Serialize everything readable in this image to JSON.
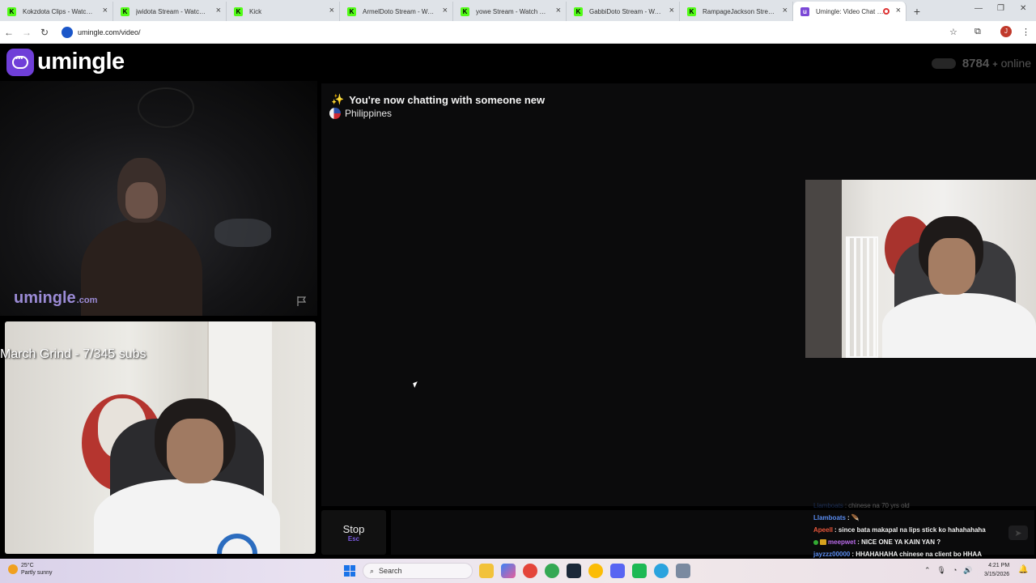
{
  "browser": {
    "tabs": [
      {
        "label": "Kokzdota Clips - Watch Live",
        "favicon": "kick-icon"
      },
      {
        "label": "jwidota Stream - Watch Live",
        "favicon": "kick-icon"
      },
      {
        "label": "Kick",
        "favicon": "kick-icon"
      },
      {
        "label": "ArmelDoto Stream - Watch",
        "favicon": "kick-icon"
      },
      {
        "label": "yowe Stream - Watch Live o",
        "favicon": "kick-icon"
      },
      {
        "label": "GabbiDoto Stream - Watch",
        "favicon": "kick-icon"
      },
      {
        "label": "RampageJackson Stream - W",
        "favicon": "kick-icon"
      },
      {
        "label": "Umingle: Video Chat with",
        "favicon": "umingle-icon",
        "active": true
      }
    ],
    "url": "umingle.com/video/",
    "profile_initial": "J"
  },
  "header": {
    "brand": "umingle",
    "online_count": "8784",
    "online_suffix": "+",
    "online_label": "online"
  },
  "partner_video": {
    "watermark_main": "umingle",
    "watermark_tld": ".com"
  },
  "self_video": {
    "overlay_text": "March Grind - 7/345 subs"
  },
  "chat": {
    "system_message": "You're now chatting with someone new",
    "country": "Philippines"
  },
  "controls": {
    "stop_label": "Stop",
    "stop_hotkey": "Esc"
  },
  "stream_chat": [
    {
      "user": "Llamboats",
      "message": "chinese na 70 yrs old",
      "user_color": "#3f6fd8",
      "faded": true
    },
    {
      "user": "Llamboats",
      "message": ":",
      "user_color": "#5a8cf0"
    },
    {
      "user": "Apeell",
      "message": ": since bata makapal na lips stick ko hahahahaha",
      "user_color": "#e8563a"
    },
    {
      "user": "meepwet",
      "message": ": NICE ONE YA KAIN YAN ?",
      "user_color": "#b86ae8",
      "badges": true
    },
    {
      "user": "jayzzz00000",
      "message": ": HHAHAHAHA chinese na client bo HHAA",
      "user_color": "#5a8cf0"
    }
  ],
  "taskbar": {
    "temperature": "25°C",
    "weather": "Partly sunny",
    "search_label": "Search",
    "time": "4:21 PM",
    "date": "3/15/2026"
  },
  "colors": {
    "brand_purple": "#6f3fd8",
    "kick_green": "#53fc18"
  }
}
